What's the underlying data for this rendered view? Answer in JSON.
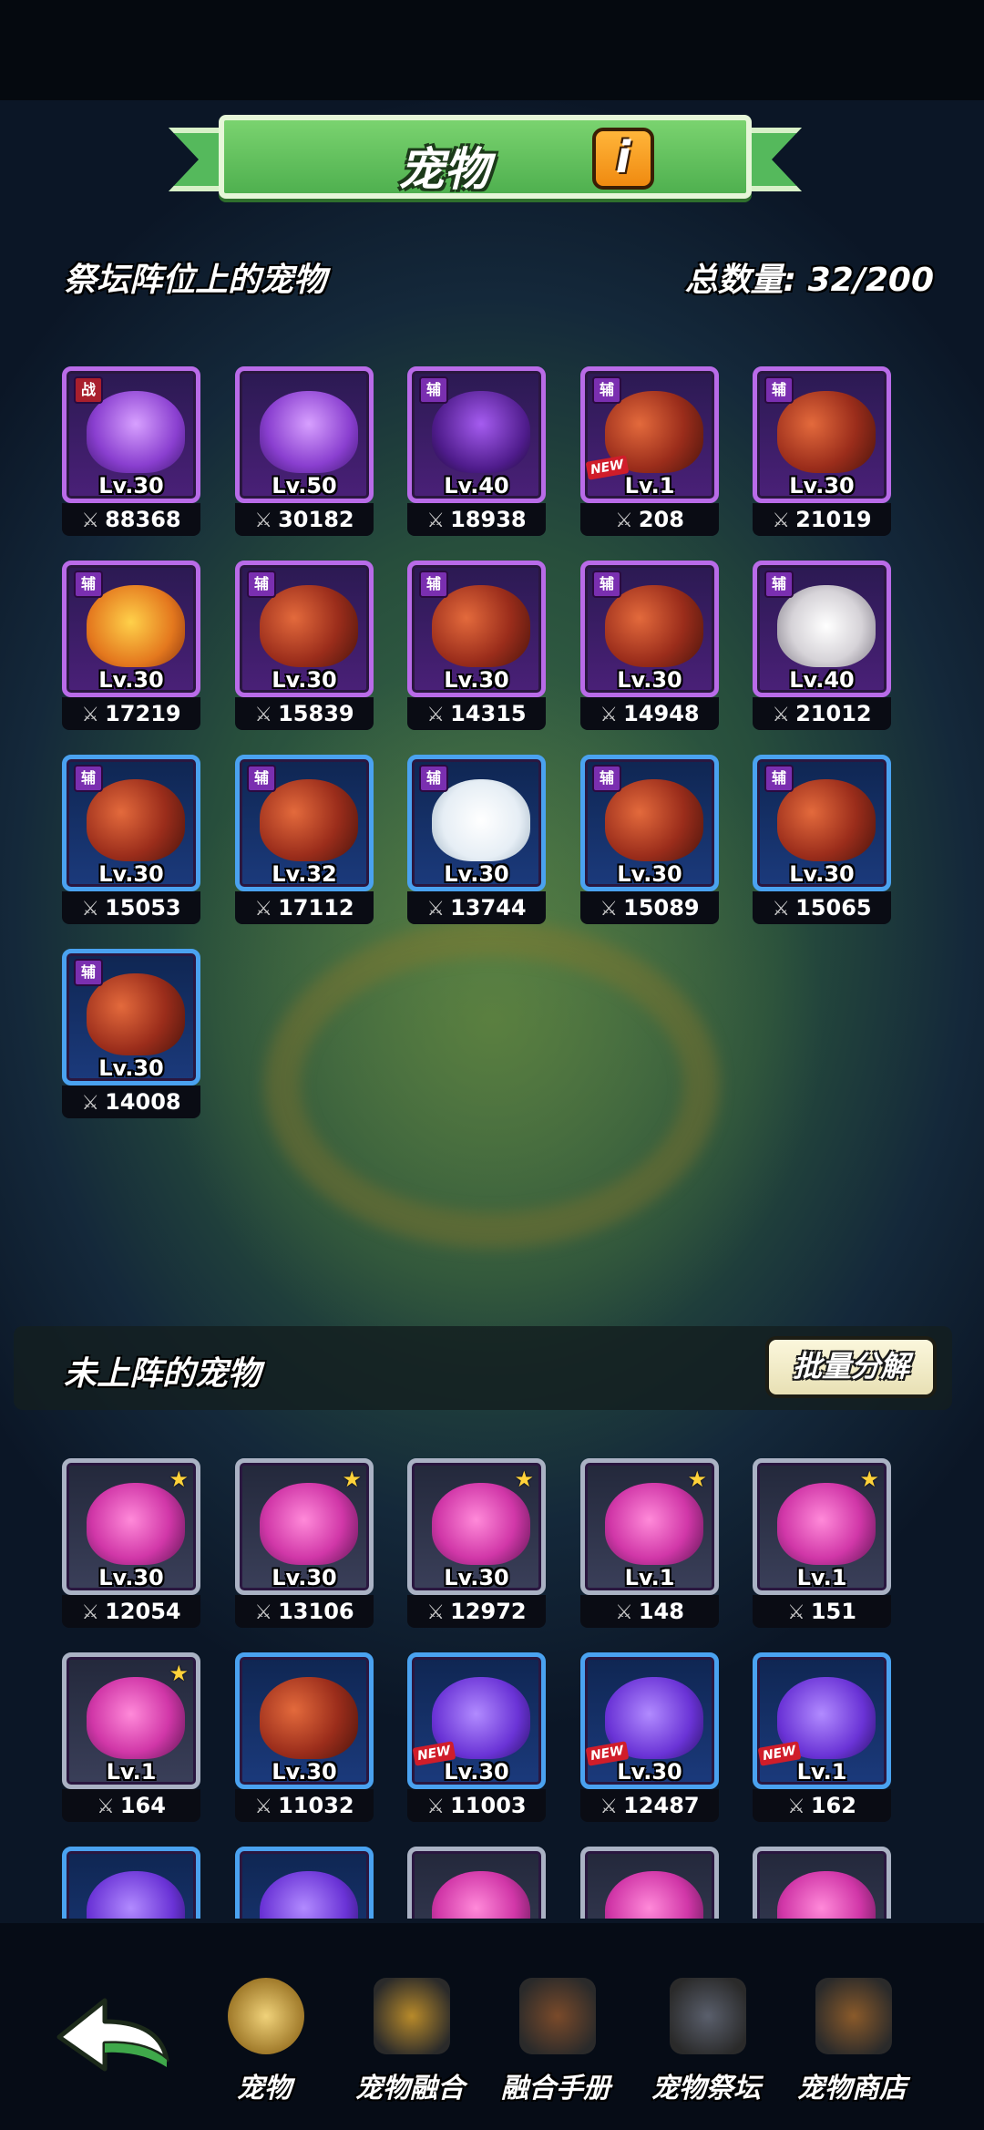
{
  "header": {
    "title": "宠物",
    "info_glyph": "i",
    "altar_section_label": "祭坛阵位上的宠物",
    "total_label": "总数量: 32/200"
  },
  "altar_pets": [
    {
      "badge": "战",
      "badge_color": "#a91f2d",
      "frame": "purple",
      "creature": "octo",
      "level": "Lv.30",
      "power": "88368"
    },
    {
      "badge": "",
      "frame": "purple",
      "creature": "octo",
      "level": "Lv.50",
      "power": "30182"
    },
    {
      "badge": "辅",
      "badge_color": "#7a2fb0",
      "frame": "purple",
      "creature": "alien",
      "level": "Lv.40",
      "power": "18938"
    },
    {
      "badge": "辅",
      "badge_color": "#7a2fb0",
      "frame": "purple",
      "creature": "scorp",
      "level": "Lv.1",
      "power": "208",
      "is_new": true
    },
    {
      "badge": "辅",
      "badge_color": "#7a2fb0",
      "frame": "purple",
      "creature": "scorp",
      "level": "Lv.30",
      "power": "21019"
    },
    {
      "badge": "辅",
      "badge_color": "#7a2fb0",
      "frame": "purple",
      "creature": "lion",
      "level": "Lv.30",
      "power": "17219"
    },
    {
      "badge": "辅",
      "badge_color": "#7a2fb0",
      "frame": "purple",
      "creature": "scorp",
      "level": "Lv.30",
      "power": "15839"
    },
    {
      "badge": "辅",
      "badge_color": "#7a2fb0",
      "frame": "purple",
      "creature": "scorp",
      "level": "Lv.30",
      "power": "14315"
    },
    {
      "badge": "辅",
      "badge_color": "#7a2fb0",
      "frame": "purple",
      "creature": "scorp",
      "level": "Lv.30",
      "power": "14948"
    },
    {
      "badge": "辅",
      "badge_color": "#7a2fb0",
      "frame": "purple",
      "creature": "boar",
      "level": "Lv.40",
      "power": "21012"
    },
    {
      "badge": "辅",
      "badge_color": "#7a2fb0",
      "frame": "blue",
      "creature": "scorp",
      "level": "Lv.30",
      "power": "15053"
    },
    {
      "badge": "辅",
      "badge_color": "#7a2fb0",
      "frame": "blue",
      "creature": "scorp",
      "level": "Lv.32",
      "power": "17112"
    },
    {
      "badge": "辅",
      "badge_color": "#7a2fb0",
      "frame": "blue",
      "creature": "bear",
      "level": "Lv.30",
      "power": "13744"
    },
    {
      "badge": "辅",
      "badge_color": "#7a2fb0",
      "frame": "blue",
      "creature": "scorp",
      "level": "Lv.30",
      "power": "15089"
    },
    {
      "badge": "辅",
      "badge_color": "#7a2fb0",
      "frame": "blue",
      "creature": "scorp",
      "level": "Lv.30",
      "power": "15065"
    },
    {
      "badge": "辅",
      "badge_color": "#7a2fb0",
      "frame": "blue",
      "creature": "scorp",
      "level": "Lv.30",
      "power": "14008"
    }
  ],
  "unassigned": {
    "label": "未上阵的宠物",
    "bulk_button": "批量分解",
    "pets": [
      {
        "frame": "grey",
        "creature": "plant",
        "level": "Lv.30",
        "power": "12054",
        "star": true
      },
      {
        "frame": "grey",
        "creature": "plant",
        "level": "Lv.30",
        "power": "13106",
        "star": true
      },
      {
        "frame": "grey",
        "creature": "plant",
        "level": "Lv.30",
        "power": "12972",
        "star": true
      },
      {
        "frame": "grey",
        "creature": "plant",
        "level": "Lv.1",
        "power": "148",
        "star": true
      },
      {
        "frame": "grey",
        "creature": "plant",
        "level": "Lv.1",
        "power": "151",
        "star": true
      },
      {
        "frame": "grey",
        "creature": "plant",
        "level": "Lv.1",
        "power": "164",
        "star": true
      },
      {
        "frame": "blue",
        "creature": "scorp",
        "level": "Lv.30",
        "power": "11032"
      },
      {
        "frame": "blue",
        "creature": "wolf",
        "level": "Lv.30",
        "power": "11003",
        "is_new": true
      },
      {
        "frame": "blue",
        "creature": "wolf",
        "level": "Lv.30",
        "power": "12487",
        "is_new": true
      },
      {
        "frame": "blue",
        "creature": "wolf",
        "level": "Lv.1",
        "power": "162",
        "is_new": true
      },
      {
        "frame": "blue",
        "creature": "wolf",
        "level": "",
        "power": ""
      },
      {
        "frame": "blue",
        "creature": "wolf",
        "level": "",
        "power": ""
      },
      {
        "frame": "grey",
        "creature": "plant",
        "level": "",
        "power": ""
      },
      {
        "frame": "grey",
        "creature": "plant",
        "level": "",
        "power": ""
      },
      {
        "frame": "grey",
        "creature": "plant",
        "level": "",
        "power": ""
      }
    ]
  },
  "labels": {
    "new_tag": "NEW",
    "power_icon": "⚔"
  },
  "nav": {
    "back_icon": "back-arrow-icon",
    "items": [
      {
        "label": "宠物",
        "icon": "pet-bell-icon",
        "active": true
      },
      {
        "label": "宠物融合",
        "icon": "fusion-icon"
      },
      {
        "label": "融合手册",
        "icon": "book-icon"
      },
      {
        "label": "宠物祭坛",
        "icon": "altar-icon"
      },
      {
        "label": "宠物商店",
        "icon": "shop-chest-icon"
      }
    ]
  }
}
